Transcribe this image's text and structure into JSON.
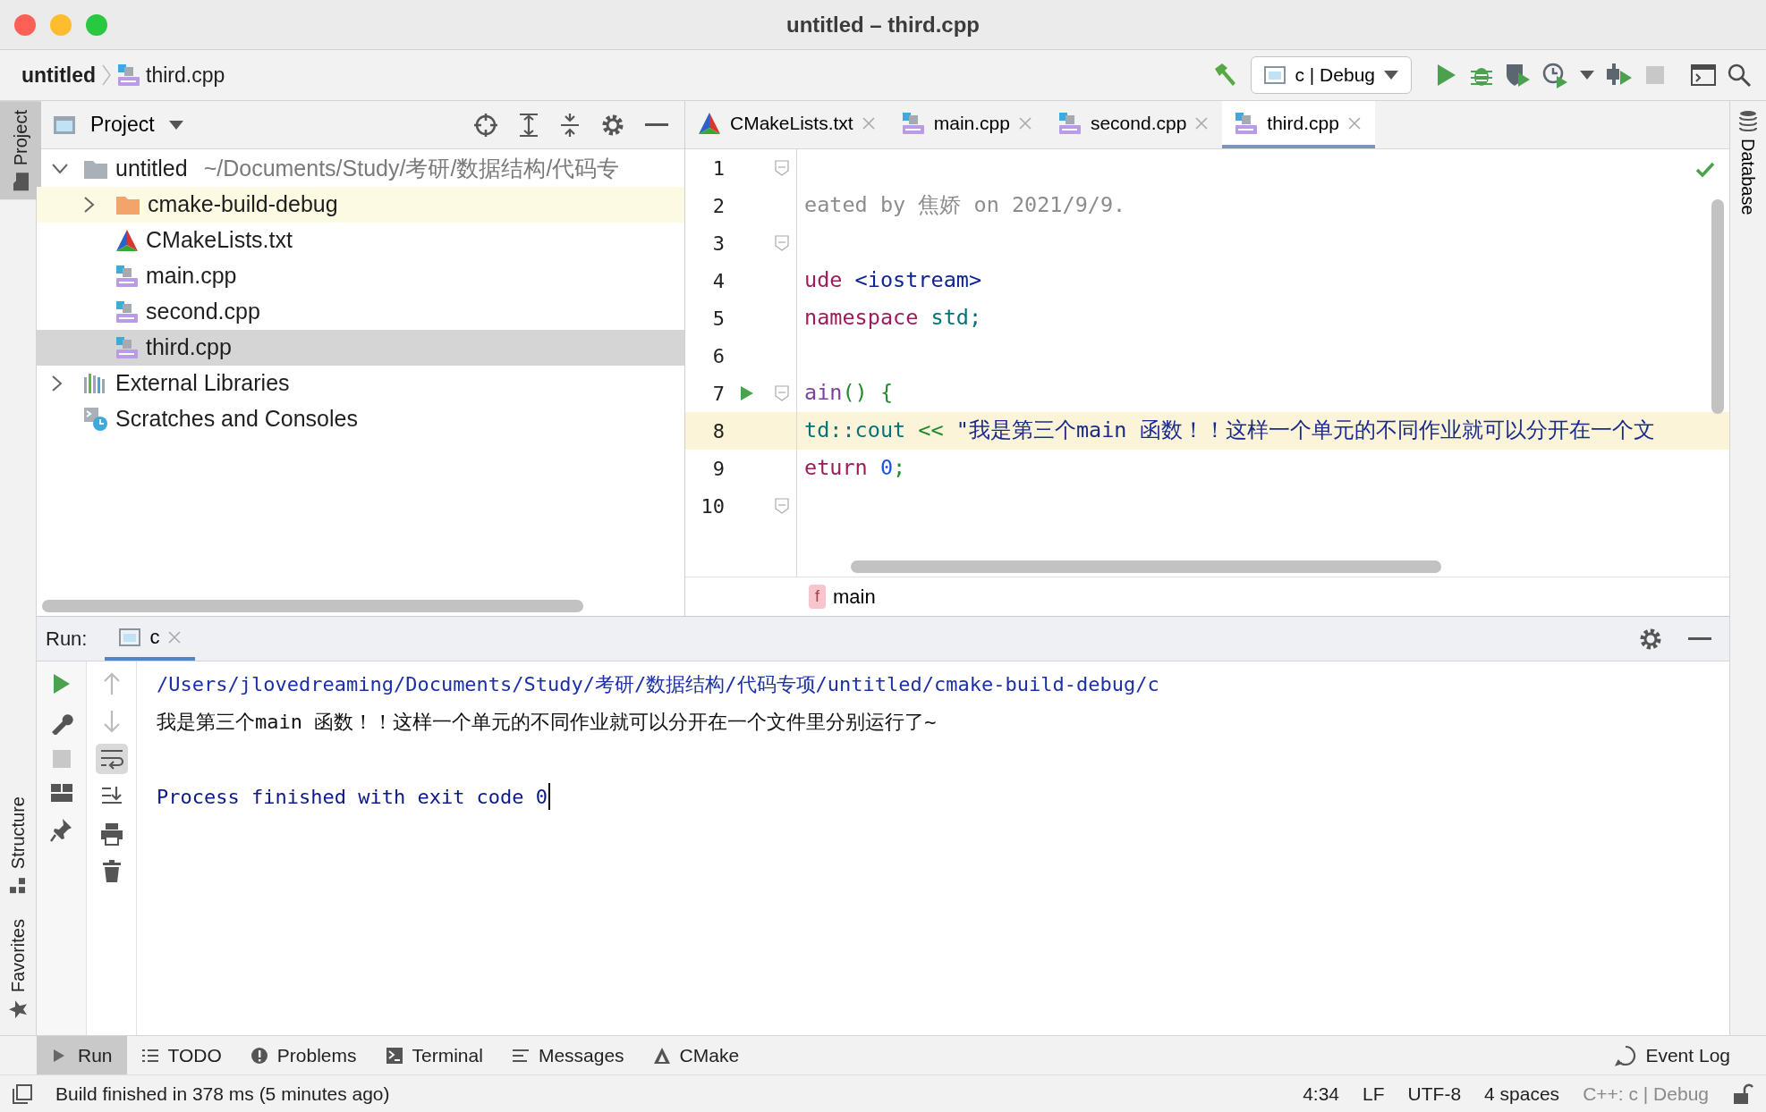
{
  "window": {
    "title": "untitled – third.cpp"
  },
  "breadcrumb": [
    {
      "label": "untitled",
      "kind": "project"
    },
    {
      "label": "third.cpp",
      "kind": "cpp"
    }
  ],
  "toolbar": {
    "run_config": "c | Debug",
    "stop_disabled": true
  },
  "left_strip": [
    {
      "label": "Project",
      "selected": true
    },
    {
      "label": "Structure",
      "selected": false
    },
    {
      "label": "Favorites",
      "selected": false
    }
  ],
  "right_strip": [
    {
      "label": "Database",
      "selected": false
    }
  ],
  "project_panel": {
    "title": "Project",
    "tree": [
      {
        "label": "untitled",
        "path": "~/Documents/Study/考研/数据结构/代码专",
        "kind": "folder",
        "expanded": true,
        "selected": false,
        "highlighted": false,
        "children": [
          {
            "label": "cmake-build-debug",
            "kind": "build-folder",
            "expanded": false,
            "selected": false,
            "highlighted": true
          },
          {
            "label": "CMakeLists.txt",
            "kind": "cmake",
            "selected": false,
            "highlighted": false
          },
          {
            "label": "main.cpp",
            "kind": "cpp",
            "selected": false,
            "highlighted": false
          },
          {
            "label": "second.cpp",
            "kind": "cpp",
            "selected": false,
            "highlighted": false
          },
          {
            "label": "third.cpp",
            "kind": "cpp",
            "selected": true,
            "highlighted": false
          }
        ]
      },
      {
        "label": "External Libraries",
        "kind": "library",
        "expanded": false,
        "selected": false,
        "highlighted": false
      },
      {
        "label": "Scratches and Consoles",
        "kind": "scratches",
        "selected": false,
        "highlighted": false
      }
    ]
  },
  "editor": {
    "tabs": [
      {
        "label": "CMakeLists.txt",
        "kind": "cmake",
        "selected": false
      },
      {
        "label": "main.cpp",
        "kind": "cpp",
        "selected": false
      },
      {
        "label": "second.cpp",
        "kind": "cpp",
        "selected": false
      },
      {
        "label": "third.cpp",
        "kind": "cpp",
        "selected": true
      }
    ],
    "lines": [
      {
        "number": "1",
        "fold": true,
        "run": false,
        "current": false
      },
      {
        "number": "2",
        "fold": false,
        "run": false,
        "current": false,
        "tokens": [
          {
            "text": "eated by 焦娇 on 2021/9/9.",
            "kind": "comment"
          }
        ]
      },
      {
        "number": "3",
        "fold": true,
        "run": false,
        "current": false
      },
      {
        "number": "4",
        "fold": false,
        "run": false,
        "current": false,
        "tokens": [
          {
            "text": "ude",
            "kind": "keyword"
          },
          {
            "text": " <iostream>",
            "kind": "header"
          }
        ]
      },
      {
        "number": "5",
        "fold": false,
        "run": false,
        "current": false,
        "tokens": [
          {
            "text": "namespace",
            "kind": "keyword"
          },
          {
            "text": " std;",
            "kind": "type"
          }
        ]
      },
      {
        "number": "6",
        "fold": false,
        "run": false,
        "current": false
      },
      {
        "number": "7",
        "fold": true,
        "run": true,
        "current": false,
        "tokens": [
          {
            "text": "ain",
            "kind": "function"
          },
          {
            "text": "() {",
            "kind": "punct"
          }
        ]
      },
      {
        "number": "8",
        "fold": false,
        "run": false,
        "current": true,
        "tokens": [
          {
            "text": "td::cout",
            "kind": "type"
          },
          {
            "text": " << ",
            "kind": "punct"
          },
          {
            "text": "\"我是第三个main 函数！！这样一个单元的不同作业就可以分开在一个文",
            "kind": "string"
          }
        ]
      },
      {
        "number": "9",
        "fold": false,
        "run": false,
        "current": false,
        "tokens": [
          {
            "text": "eturn",
            "kind": "keyword"
          },
          {
            "text": " 0",
            "kind": "number"
          },
          {
            "text": ";",
            "kind": "punct"
          }
        ]
      },
      {
        "number": "10",
        "fold": true,
        "run": false,
        "current": false
      }
    ],
    "breadcrumb": {
      "symbol": "f",
      "label": "main"
    }
  },
  "run_panel": {
    "label": "Run:",
    "tabs": [
      {
        "label": "c",
        "selected": true
      }
    ],
    "console": [
      {
        "text": "/Users/jlovedreaming/Documents/Study/考研/数据结构/代码专项/untitled/cmake-build-debug/c",
        "kind": "path",
        "caret": false
      },
      {
        "text": "我是第三个main 函数！！这样一个单元的不同作业就可以分开在一个文件里分别运行了~",
        "kind": "output",
        "caret": false
      },
      {
        "text": "Process finished with exit code 0",
        "kind": "exit",
        "caret": true
      }
    ]
  },
  "tool_windows": [
    {
      "label": "Run",
      "kind": "run",
      "selected": true
    },
    {
      "label": "TODO",
      "kind": "todo",
      "selected": false
    },
    {
      "label": "Problems",
      "kind": "problems",
      "selected": false
    },
    {
      "label": "Terminal",
      "kind": "terminal",
      "selected": false
    },
    {
      "label": "Messages",
      "kind": "messages",
      "selected": false
    },
    {
      "label": "CMake",
      "kind": "cmake",
      "selected": false
    }
  ],
  "event_log": "Event Log",
  "status_bar": {
    "message": "Build finished in 378 ms (5 minutes ago)",
    "items": [
      "4:34",
      "LF",
      "UTF-8",
      "4 spaces"
    ],
    "context": "C++: c | Debug"
  }
}
